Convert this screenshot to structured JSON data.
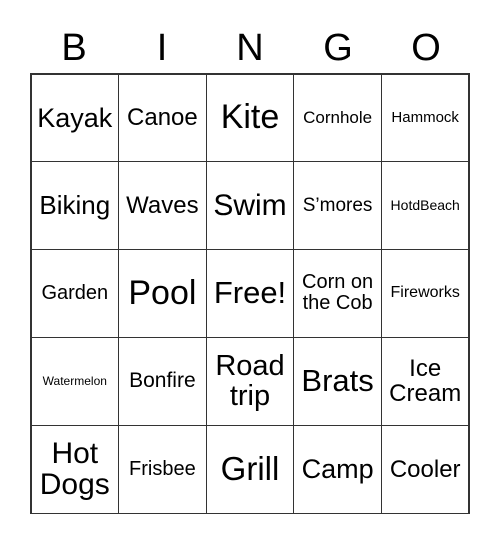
{
  "header": [
    "B",
    "I",
    "N",
    "G",
    "O"
  ],
  "cells": [
    {
      "t": "Kayak",
      "s": 27
    },
    {
      "t": "Canoe",
      "s": 24
    },
    {
      "t": "Kite",
      "s": 34
    },
    {
      "t": "Cornhole",
      "s": 17
    },
    {
      "t": "Hammock",
      "s": 15
    },
    {
      "t": "Biking",
      "s": 26
    },
    {
      "t": "Waves",
      "s": 24
    },
    {
      "t": "Swim",
      "s": 30
    },
    {
      "t": "S’mores",
      "s": 19
    },
    {
      "t": "HotdBeach",
      "s": 14
    },
    {
      "t": "Garden",
      "s": 20
    },
    {
      "t": "Pool",
      "s": 34
    },
    {
      "t": "Free!",
      "s": 31
    },
    {
      "t": "Corn on the Cob",
      "s": 20
    },
    {
      "t": "Fireworks",
      "s": 16
    },
    {
      "t": "Watermelon",
      "s": 12
    },
    {
      "t": "Bonfire",
      "s": 21
    },
    {
      "t": "Road trip",
      "s": 29
    },
    {
      "t": "Brats",
      "s": 31
    },
    {
      "t": "Ice Cream",
      "s": 24
    },
    {
      "t": "Hot Dogs",
      "s": 30
    },
    {
      "t": "Frisbee",
      "s": 20
    },
    {
      "t": "Grill",
      "s": 33
    },
    {
      "t": "Camp",
      "s": 27
    },
    {
      "t": "Cooler",
      "s": 24
    }
  ]
}
